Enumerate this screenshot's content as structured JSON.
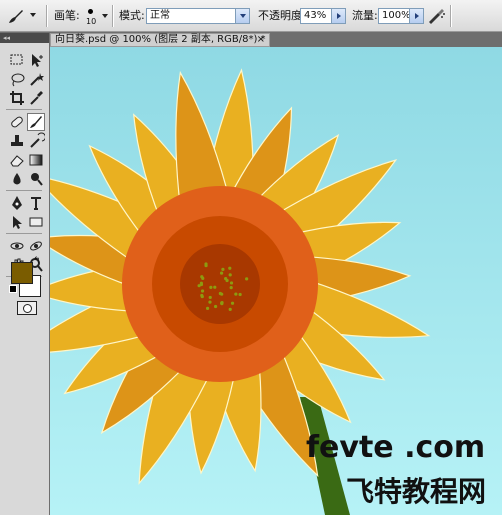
{
  "options_bar": {
    "brush_label": "画笔:",
    "brush_size": "10",
    "mode_label": "模式:",
    "mode_value": "正常",
    "opacity_label": "不透明度:",
    "opacity_value": "43%",
    "flow_label": "流量:",
    "flow_value": "100%"
  },
  "document": {
    "tab_title": "向日葵.psd @ 100% (图层 2 副本, RGB/8*) *",
    "close": "×"
  },
  "toolbox": {
    "collapse": "◂◂",
    "foreground_color": "#7a5c00",
    "background_color": "#ffffff"
  },
  "canvas_colors": {
    "sky_top": "#8fd9e4",
    "sky_bottom": "#b6f2f6",
    "petal": "#e9b021",
    "petal_dark": "#dd9418",
    "center_outer": "#e0601a",
    "center_mid": "#c84a00",
    "center_inner": "#a83800",
    "seed": "#8d9a10",
    "stem": "#3a6a14"
  },
  "watermark": {
    "line1": "fevte .com",
    "line2": "飞特教程网"
  }
}
